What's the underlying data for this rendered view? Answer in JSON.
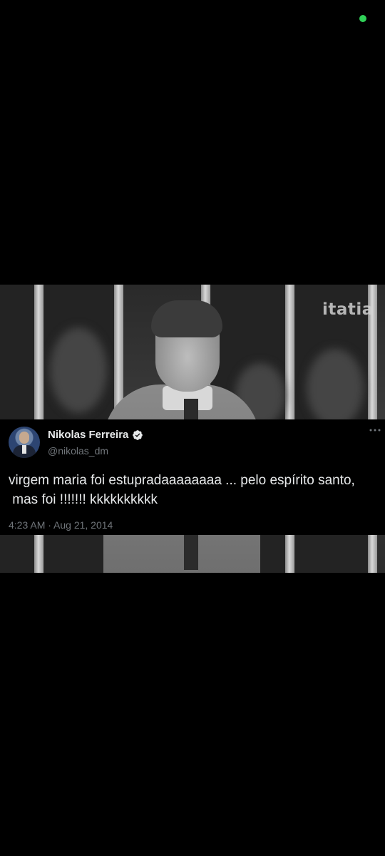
{
  "status_bar": {
    "indicator_color": "#30d158"
  },
  "video": {
    "watermark": "itatia"
  },
  "tweet": {
    "display_name": "Nikolas Ferreira",
    "handle": "@nikolas_dm",
    "verified": true,
    "text": "virgem maria foi estupradaaaaaaaa ... pelo espírito santo,\n mas foi !!!!!!! kkkkkkkkkk",
    "timestamp": "4:23 AM · Aug 21, 2014",
    "colors": {
      "text": "#e7e9ea",
      "secondary": "#71767b",
      "verified_badge": "#e7e9ea"
    }
  },
  "icons": [
    "verified-badge-icon",
    "more-options-icon"
  ]
}
